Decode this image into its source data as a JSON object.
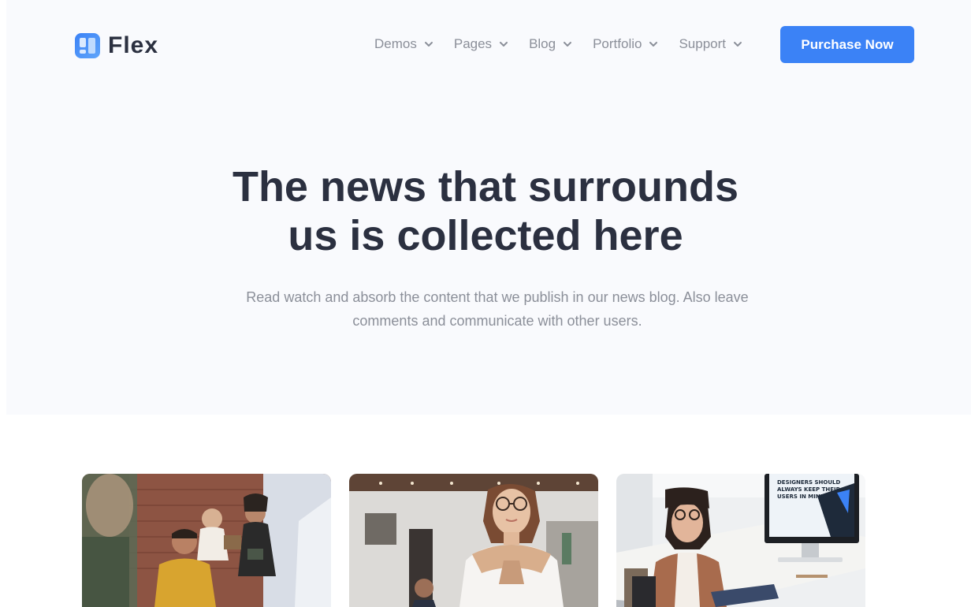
{
  "brand": {
    "name": "Flex",
    "accent": "#3b82f6"
  },
  "nav": {
    "items": [
      {
        "label": "Demos"
      },
      {
        "label": "Pages"
      },
      {
        "label": "Blog"
      },
      {
        "label": "Portfolio"
      },
      {
        "label": "Support"
      }
    ],
    "purchase_label": "Purchase Now"
  },
  "hero": {
    "title_line1": "The news that surrounds",
    "title_line2": "us is collected here",
    "subtitle_line1": "Read watch and absorb the content that we publish in our news blog. Also leave",
    "subtitle_line2": "comments and communicate with other users."
  },
  "posts": [
    {
      "image": "team-meeting-photo"
    },
    {
      "image": "woman-portrait-photo"
    },
    {
      "image": "designer-desk-photo",
      "screen_text_1": "DESIGNERS SHOULD",
      "screen_text_2": "ALWAYS KEEP THEIR",
      "screen_text_3": "USERS IN MIND."
    }
  ]
}
